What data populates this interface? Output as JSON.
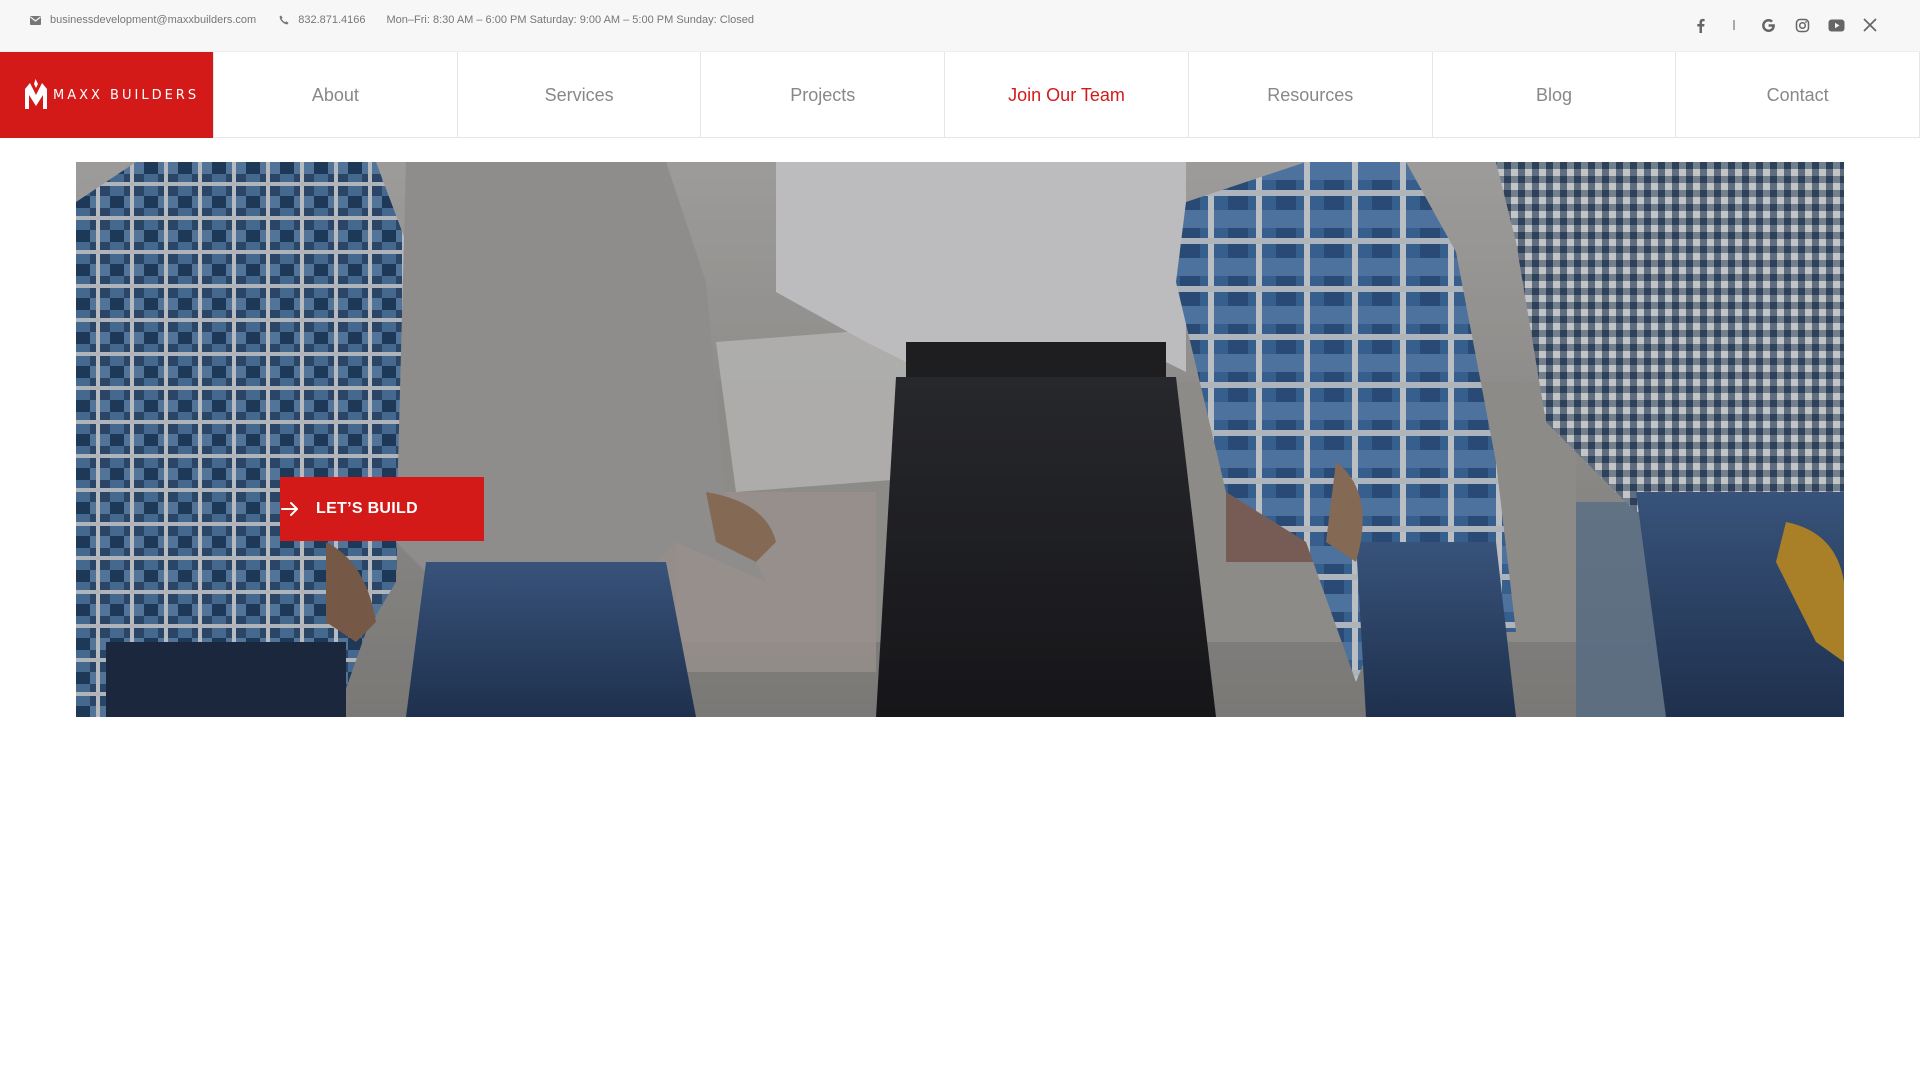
{
  "topbar": {
    "email": "businessdevelopment@maxxbuilders.com",
    "phone": "832.871.4166",
    "hours": "Mon–Fri: 8:30 AM – 6:00 PM Saturday: 9:00 AM – 5:00 PM Sunday: Closed",
    "icons": {
      "email": "envelope-icon",
      "phone": "phone-icon"
    },
    "social": [
      "facebook-icon",
      "linkedin-icon",
      "google-icon",
      "instagram-icon",
      "youtube-icon",
      "x-icon"
    ]
  },
  "header": {
    "logo_text": "MAXX BUILDERS",
    "nav": [
      {
        "label": "About"
      },
      {
        "label": "Services"
      },
      {
        "label": "Projects"
      },
      {
        "label": "Join Our Team"
      },
      {
        "label": "Resources"
      },
      {
        "label": "Blog"
      },
      {
        "label": "Contact"
      }
    ],
    "active_nav": "Join Our Team"
  },
  "hero": {
    "cta_label": "LET’S BUILD",
    "cta_icon": "arrow-right-icon"
  },
  "colors": {
    "brand_red": "#d31a18",
    "nav_text": "#888888",
    "topbar_bg": "#f7f7f7"
  }
}
